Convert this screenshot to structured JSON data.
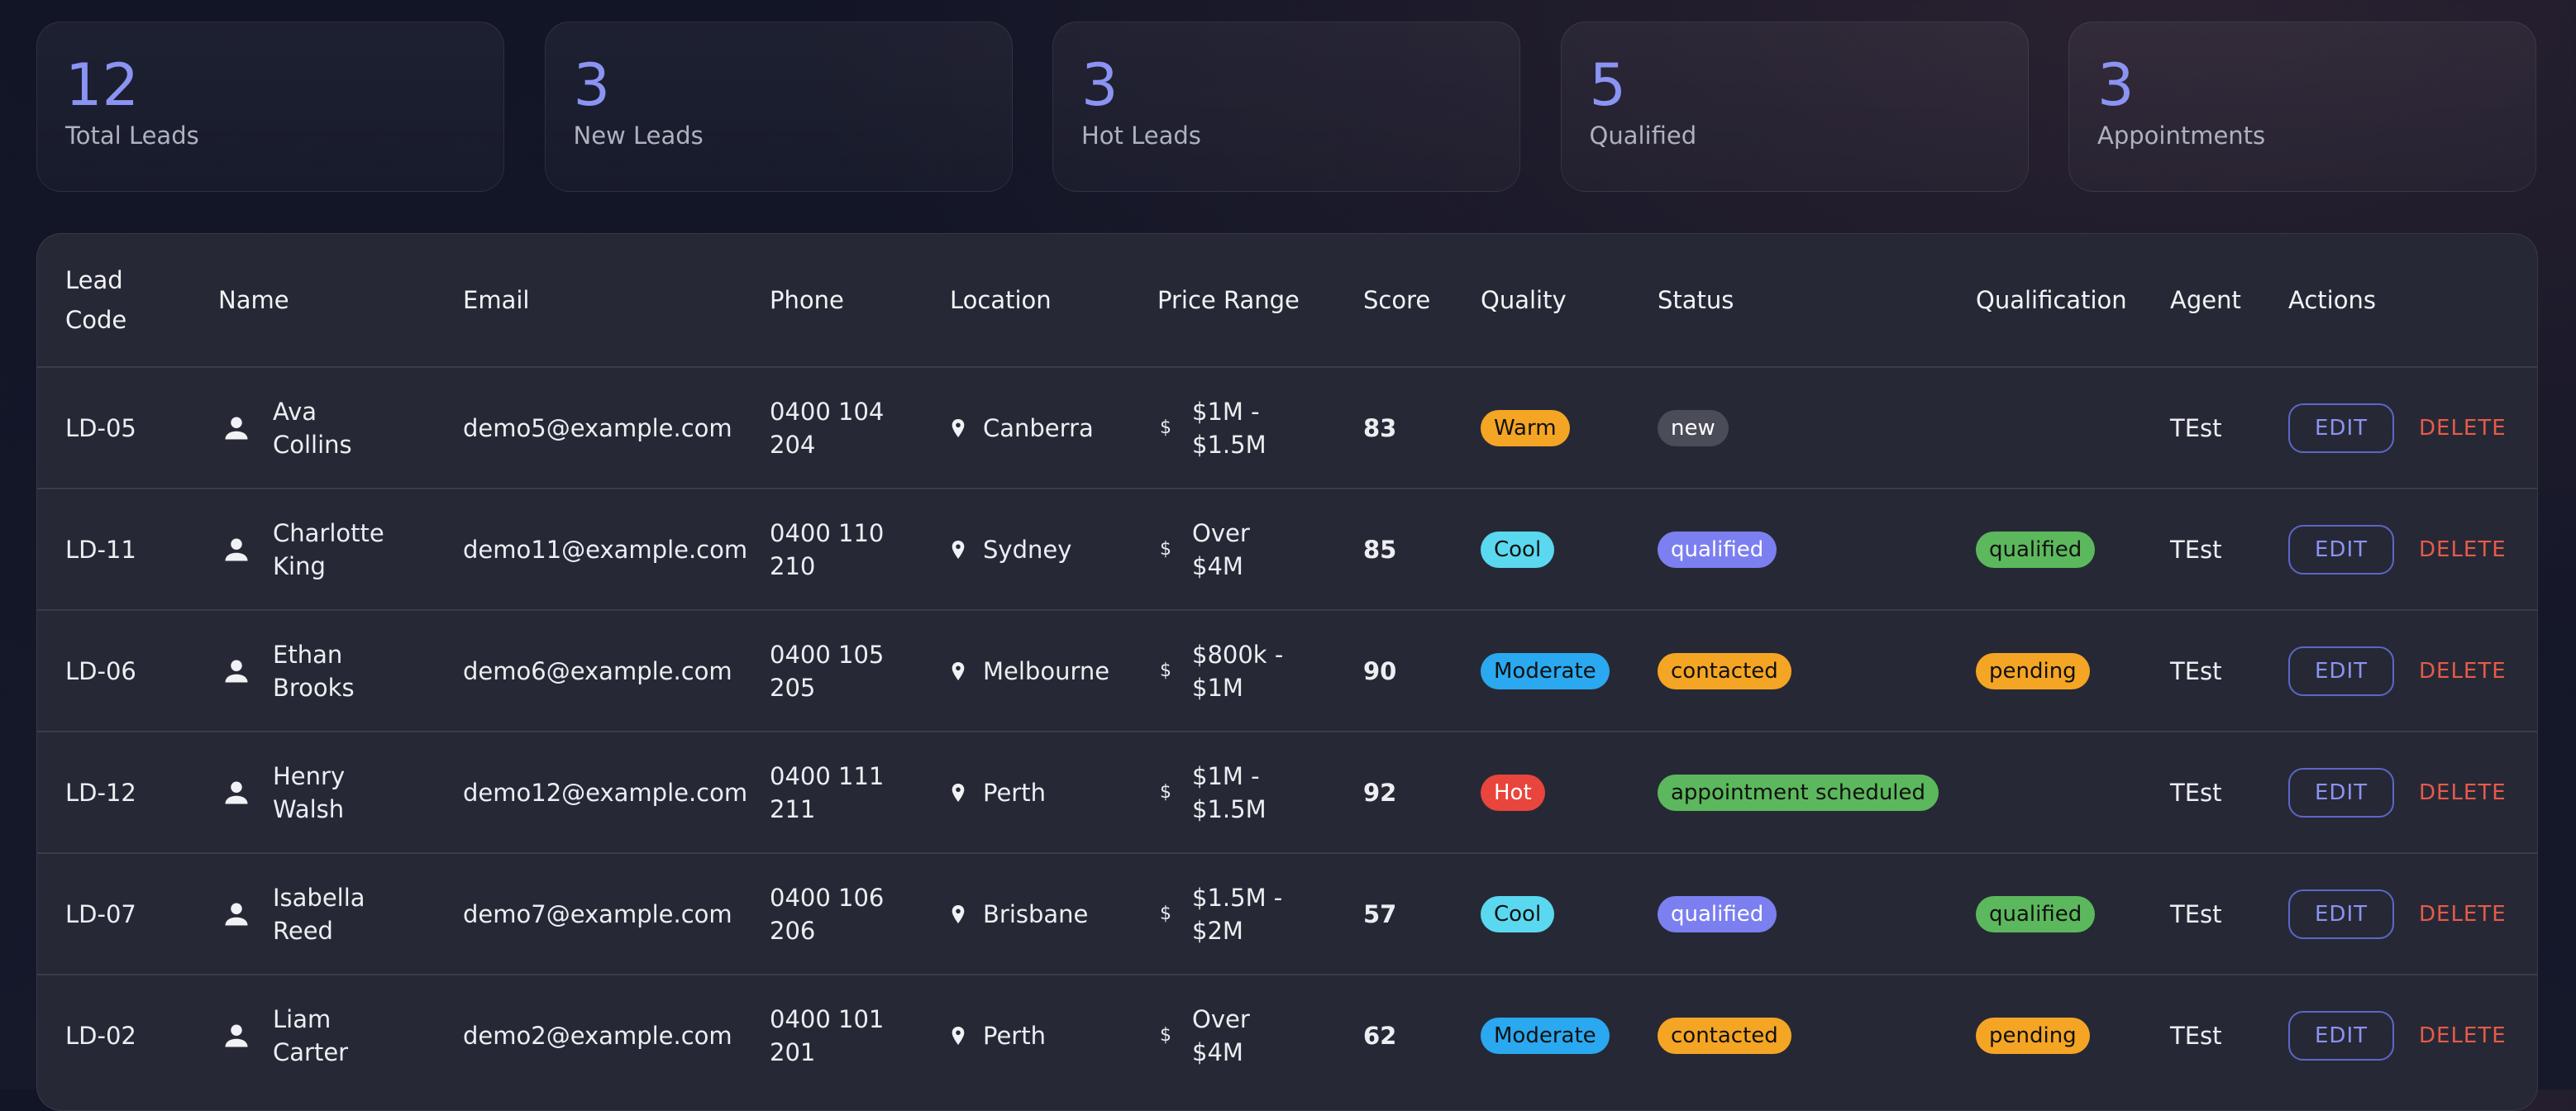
{
  "stats": [
    {
      "value": "12",
      "label": "Total Leads"
    },
    {
      "value": "3",
      "label": "New Leads"
    },
    {
      "value": "3",
      "label": "Hot Leads"
    },
    {
      "value": "5",
      "label": "Qualified"
    },
    {
      "value": "3",
      "label": "Appointments"
    }
  ],
  "table": {
    "headers": {
      "lead_code": "Lead Code",
      "name": "Name",
      "email": "Email",
      "phone": "Phone",
      "location": "Location",
      "price_range": "Price Range",
      "score": "Score",
      "quality": "Quality",
      "status": "Status",
      "qualification": "Qualification",
      "agent": "Agent",
      "actions": "Actions"
    },
    "actions": {
      "edit": "EDIT",
      "delete": "DELETE"
    },
    "rows": [
      {
        "code": "LD-05",
        "name": "Ava Collins",
        "email": "demo5@example.com",
        "phone": "0400 104 204",
        "location": "Canberra",
        "price": "$1M - $1.5M",
        "score": "83",
        "quality": "Warm",
        "status": "new",
        "qualification": "",
        "agent": "TEst"
      },
      {
        "code": "LD-11",
        "name": "Charlotte King",
        "email": "demo11@example.com",
        "phone": "0400 110 210",
        "location": "Sydney",
        "price": "Over $4M",
        "score": "85",
        "quality": "Cool",
        "status": "qualified",
        "qualification": "qualified",
        "agent": "TEst"
      },
      {
        "code": "LD-06",
        "name": "Ethan Brooks",
        "email": "demo6@example.com",
        "phone": "0400 105 205",
        "location": "Melbourne",
        "price": "$800k - $1M",
        "score": "90",
        "quality": "Moderate",
        "status": "contacted",
        "qualification": "pending",
        "agent": "TEst"
      },
      {
        "code": "LD-12",
        "name": "Henry Walsh",
        "email": "demo12@example.com",
        "phone": "0400 111 211",
        "location": "Perth",
        "price": "$1M - $1.5M",
        "score": "92",
        "quality": "Hot",
        "status": "appointment scheduled",
        "qualification": "",
        "agent": "TEst"
      },
      {
        "code": "LD-07",
        "name": "Isabella Reed",
        "email": "demo7@example.com",
        "phone": "0400 106 206",
        "location": "Brisbane",
        "price": "$1.5M - $2M",
        "score": "57",
        "quality": "Cool",
        "status": "qualified",
        "qualification": "qualified",
        "agent": "TEst"
      },
      {
        "code": "LD-02",
        "name": "Liam Carter",
        "email": "demo2@example.com",
        "phone": "0400 101 201",
        "location": "Perth",
        "price": "Over $4M",
        "score": "62",
        "quality": "Moderate",
        "status": "contacted",
        "qualification": "pending",
        "agent": "TEst"
      }
    ]
  },
  "icons": {
    "name": "person-icon",
    "location": "location-pin-icon",
    "price": "dollar-icon"
  },
  "colors": {
    "accent": "#8b93f3",
    "quality": {
      "Warm": "#f5a524",
      "Cool": "#5ad8f0",
      "Moderate": "#2aa8f0",
      "Hot": "#e8453c"
    },
    "status": {
      "new": "#4a4d58",
      "qualified": "#7b7ff0",
      "contacted": "#f5a524",
      "appointment scheduled": "#5cb85c"
    },
    "qualification": {
      "qualified": "#5cb85c",
      "pending": "#f5a524"
    },
    "delete": "#e85a4a"
  }
}
